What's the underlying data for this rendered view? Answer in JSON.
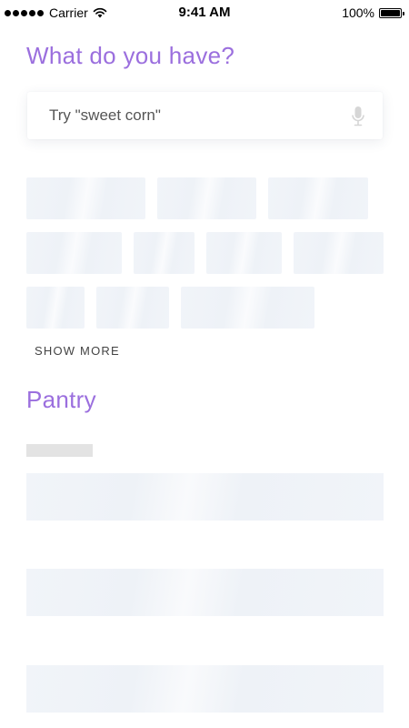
{
  "status_bar": {
    "carrier": "Carrier",
    "time": "9:41 AM",
    "battery": "100%"
  },
  "header": {
    "title": "What do you have?"
  },
  "search": {
    "value": "",
    "placeholder": "Try \"sweet corn\"",
    "mic_icon": "microphone-icon"
  },
  "ingredients": {
    "show_more_label": "SHOW MORE"
  },
  "pantry": {
    "title": "Pantry"
  },
  "colors": {
    "accent": "#9b6fde",
    "skeleton": "#f1f4f9",
    "skeleton_label": "#e3e3e3"
  }
}
